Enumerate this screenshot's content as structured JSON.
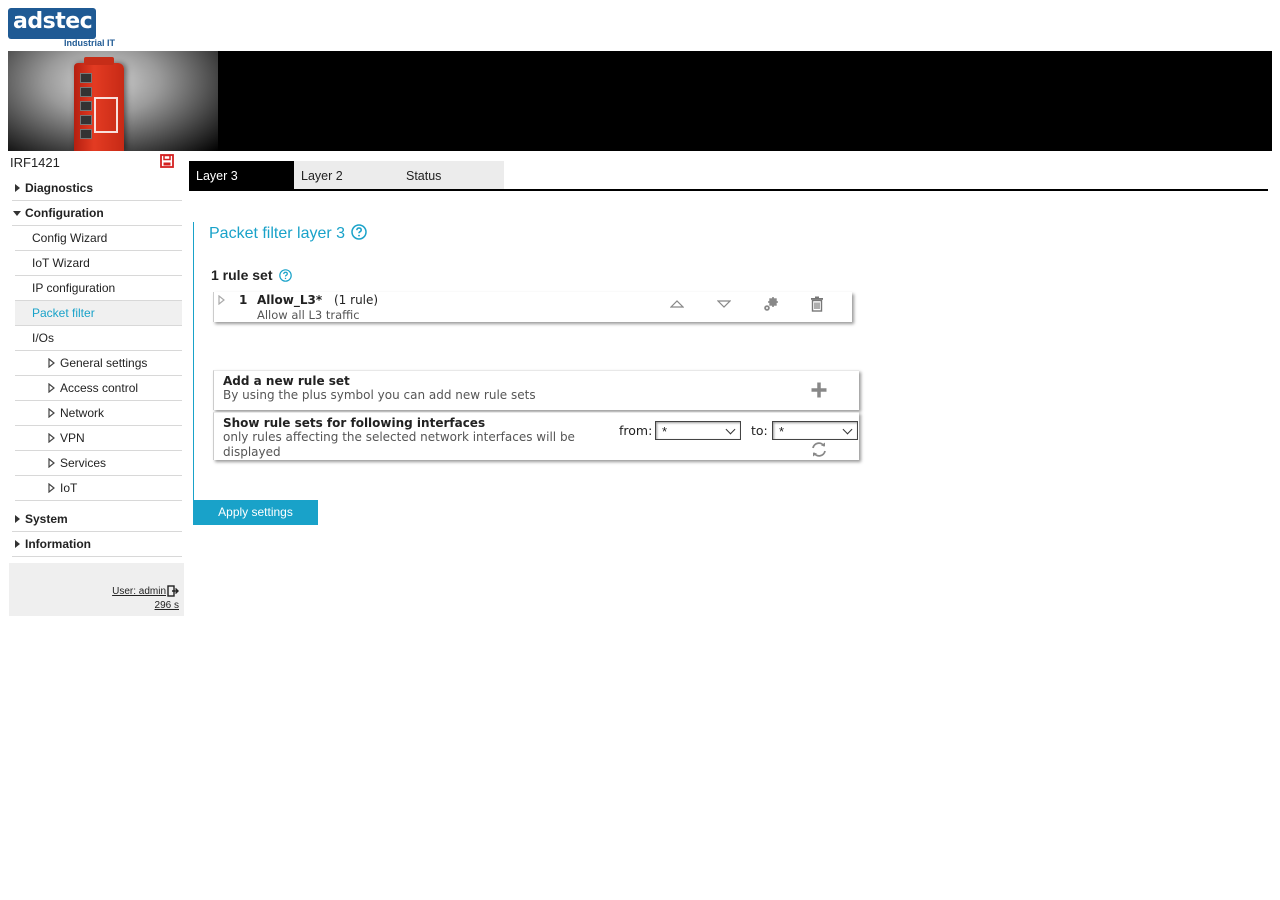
{
  "brand": {
    "logo_text": "adstec",
    "logo_sub": "Industrial IT"
  },
  "device": {
    "name": "IRF1421"
  },
  "sidebar": {
    "items": [
      {
        "label": "Diagnostics"
      },
      {
        "label": "Configuration"
      },
      {
        "label": "Config Wizard"
      },
      {
        "label": "IoT Wizard"
      },
      {
        "label": "IP configuration"
      },
      {
        "label": "Packet filter"
      },
      {
        "label": "I/Os"
      },
      {
        "label": "General settings"
      },
      {
        "label": "Access control"
      },
      {
        "label": "Network"
      },
      {
        "label": "VPN"
      },
      {
        "label": "Services"
      },
      {
        "label": "IoT"
      },
      {
        "label": "System"
      },
      {
        "label": "Information"
      }
    ]
  },
  "user": {
    "label": "User: admin",
    "session": "296 s"
  },
  "tabs": [
    {
      "label": "Layer 3"
    },
    {
      "label": "Layer 2"
    },
    {
      "label": "Status"
    }
  ],
  "main": {
    "title": "Packet filter layer 3",
    "ruleset_count": "1 rule set",
    "rule": {
      "number": "1",
      "name": "Allow_L3*",
      "count": "(1 rule)",
      "description": "Allow all L3 traffic"
    },
    "add_panel": {
      "title": "Add a new rule set",
      "subtitle": "By using the plus symbol you can add new rule sets"
    },
    "filter_panel": {
      "title": "Show rule sets for following interfaces",
      "subtitle": "only rules affecting the selected network interfaces will be displayed",
      "from_label": "from:",
      "from_value": "*",
      "to_label": "to:",
      "to_value": "*"
    },
    "apply_label": "Apply settings"
  },
  "colors": {
    "accent": "#19a2c9",
    "brand": "#1f5a94",
    "active_tab": "#000000"
  },
  "icons": [
    "save-icon",
    "help-icon",
    "expand-icon",
    "move-up-icon",
    "move-down-icon",
    "settings-icon",
    "delete-icon",
    "add-icon",
    "refresh-icon",
    "logout-icon"
  ]
}
